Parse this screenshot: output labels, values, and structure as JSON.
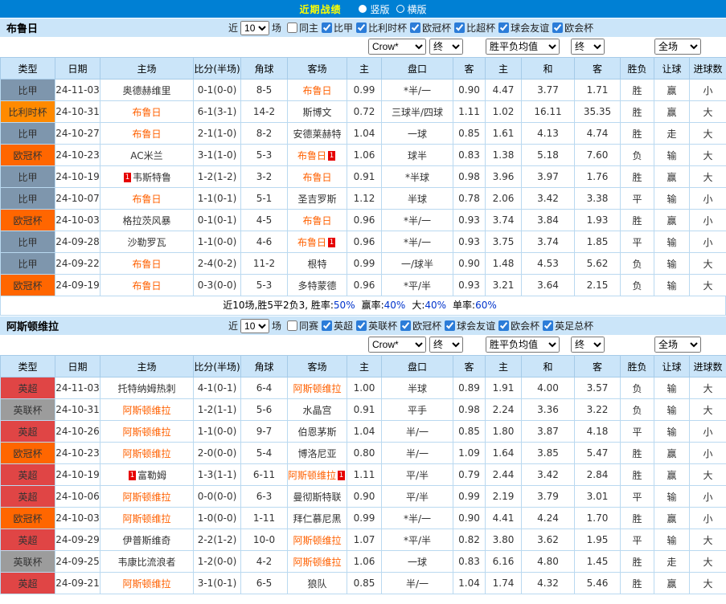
{
  "topbar": {
    "title": "近期战绩",
    "vertical": "竖版",
    "horizontal": "横版"
  },
  "columns": [
    "类型",
    "日期",
    "主场",
    "比分(半场)",
    "角球",
    "客场",
    "主",
    "盘口",
    "客",
    "主",
    "和",
    "客",
    "胜负",
    "让球",
    "进球数"
  ],
  "league_colors": {
    "比甲": "#7E96AD",
    "比利时杯": "#FF8A00",
    "欧冠杯": "#FF6600",
    "英超": "#E04545",
    "英联杯": "#9C9C9C"
  },
  "sections": [
    {
      "team": "布鲁日",
      "near_label": "近",
      "count": "10",
      "unit_label": "场",
      "filters": [
        {
          "label": "同主",
          "checked": false
        },
        {
          "label": "比甲",
          "checked": true
        },
        {
          "label": "比利时杯",
          "checked": true
        },
        {
          "label": "欧冠杯",
          "checked": true
        },
        {
          "label": "比超杯",
          "checked": true
        },
        {
          "label": "球会友谊",
          "checked": true
        },
        {
          "label": "欧会杯",
          "checked": true
        }
      ],
      "selects": [
        "Crow*",
        "终",
        "胜平负均值",
        "终",
        "全场"
      ],
      "rows": [
        {
          "league": "比甲",
          "date": "24-11-03",
          "home": "奥德赫维里",
          "home_hl": false,
          "home_card": "",
          "score": "0-1(0-0)",
          "corner": "8-5",
          "away": "布鲁日",
          "away_hl": true,
          "away_card": "",
          "h1": "0.99",
          "hcap": "*半/一",
          "hcap_c": "r",
          "h2": "0.90",
          "a1": "4.47",
          "a2": "3.77",
          "a3": "1.71",
          "wdl": "胜",
          "wdl_c": "r",
          "hr": "赢",
          "hr_c": "r",
          "ou": "小",
          "ou_c": "b"
        },
        {
          "league": "比利时杯",
          "date": "24-10-31",
          "home": "布鲁日",
          "home_hl": true,
          "home_card": "",
          "score": "6-1(3-1)",
          "corner": "14-2",
          "away": "斯博文",
          "away_hl": false,
          "away_card": "",
          "h1": "0.72",
          "hcap": "三球半/四球",
          "hcap_c": "r",
          "h2": "1.11",
          "a1": "1.02",
          "a2": "16.11",
          "a3": "35.35",
          "wdl": "胜",
          "wdl_c": "r",
          "hr": "赢",
          "hr_c": "r",
          "ou": "大",
          "ou_c": "r"
        },
        {
          "league": "比甲",
          "date": "24-10-27",
          "home": "布鲁日",
          "home_hl": true,
          "home_card": "",
          "score": "2-1(1-0)",
          "corner": "8-2",
          "away": "安德莱赫特",
          "away_hl": false,
          "away_card": "",
          "h1": "1.04",
          "hcap": "一球",
          "hcap_c": "b",
          "h2": "0.85",
          "a1": "1.61",
          "a2": "4.13",
          "a3": "4.74",
          "wdl": "胜",
          "wdl_c": "r",
          "hr": "走",
          "hr_c": "b",
          "ou": "大",
          "ou_c": "r"
        },
        {
          "league": "欧冠杯",
          "date": "24-10-23",
          "home": "AC米兰",
          "home_hl": false,
          "home_card": "",
          "score": "3-1(1-0)",
          "corner": "5-3",
          "away": "布鲁日",
          "away_hl": true,
          "away_card": "1",
          "h1": "1.06",
          "hcap": "球半",
          "hcap_c": "b",
          "h2": "0.83",
          "a1": "1.38",
          "a2": "5.18",
          "a3": "7.60",
          "wdl": "负",
          "wdl_c": "g",
          "hr": "输",
          "hr_c": "g",
          "ou": "大",
          "ou_c": "r"
        },
        {
          "league": "比甲",
          "date": "24-10-19",
          "home": "韦斯特鲁",
          "home_hl": false,
          "home_card": "1",
          "score": "1-2(1-2)",
          "corner": "3-2",
          "away": "布鲁日",
          "away_hl": true,
          "away_card": "",
          "h1": "0.91",
          "hcap": "*半球",
          "hcap_c": "r",
          "h2": "0.98",
          "a1": "3.96",
          "a2": "3.97",
          "a3": "1.76",
          "wdl": "胜",
          "wdl_c": "r",
          "hr": "赢",
          "hr_c": "r",
          "ou": "大",
          "ou_c": "r"
        },
        {
          "league": "比甲",
          "date": "24-10-07",
          "home": "布鲁日",
          "home_hl": true,
          "home_card": "",
          "score": "1-1(0-1)",
          "corner": "5-1",
          "away": "圣吉罗斯",
          "away_hl": false,
          "away_card": "",
          "h1": "1.12",
          "hcap": "半球",
          "hcap_c": "b",
          "h2": "0.78",
          "a1": "2.06",
          "a2": "3.42",
          "a3": "3.38",
          "wdl": "平",
          "wdl_c": "b",
          "hr": "输",
          "hr_c": "g",
          "ou": "小",
          "ou_c": "b"
        },
        {
          "league": "欧冠杯",
          "date": "24-10-03",
          "home": "格拉茨风暴",
          "home_hl": false,
          "home_card": "",
          "score": "0-1(0-1)",
          "corner": "4-5",
          "away": "布鲁日",
          "away_hl": true,
          "away_card": "",
          "h1": "0.96",
          "hcap": "*半/一",
          "hcap_c": "r",
          "h2": "0.93",
          "a1": "3.74",
          "a2": "3.84",
          "a3": "1.93",
          "wdl": "胜",
          "wdl_c": "r",
          "hr": "赢",
          "hr_c": "r",
          "ou": "小",
          "ou_c": "b"
        },
        {
          "league": "比甲",
          "date": "24-09-28",
          "home": "沙勒罗瓦",
          "home_hl": false,
          "home_card": "",
          "score": "1-1(0-0)",
          "corner": "4-6",
          "away": "布鲁日",
          "away_hl": true,
          "away_card": "1",
          "h1": "0.96",
          "hcap": "*半/一",
          "hcap_c": "r",
          "h2": "0.93",
          "a1": "3.75",
          "a2": "3.74",
          "a3": "1.85",
          "wdl": "平",
          "wdl_c": "b",
          "hr": "输",
          "hr_c": "g",
          "ou": "小",
          "ou_c": "b"
        },
        {
          "league": "比甲",
          "date": "24-09-22",
          "home": "布鲁日",
          "home_hl": true,
          "home_card": "",
          "score": "2-4(0-2)",
          "corner": "11-2",
          "away": "根特",
          "away_hl": false,
          "away_card": "",
          "h1": "0.99",
          "hcap": "一/球半",
          "hcap_c": "b",
          "h2": "0.90",
          "a1": "1.48",
          "a2": "4.53",
          "a3": "5.62",
          "wdl": "负",
          "wdl_c": "g",
          "hr": "输",
          "hr_c": "g",
          "ou": "大",
          "ou_c": "r"
        },
        {
          "league": "欧冠杯",
          "date": "24-09-19",
          "home": "布鲁日",
          "home_hl": true,
          "home_card": "",
          "score": "0-3(0-0)",
          "corner": "5-3",
          "away": "多特蒙德",
          "away_hl": false,
          "away_card": "",
          "h1": "0.96",
          "hcap": "*平/半",
          "hcap_c": "r",
          "h2": "0.93",
          "a1": "3.21",
          "a2": "3.64",
          "a3": "2.15",
          "wdl": "负",
          "wdl_c": "g",
          "hr": "输",
          "hr_c": "g",
          "ou": "大",
          "ou_c": "r"
        }
      ],
      "summary": {
        "lead": "近10场,胜5平2负3, ",
        "stats": [
          {
            "label": "胜率:",
            "value": "50%"
          },
          {
            "label": "赢率:",
            "value": "40%"
          },
          {
            "label": "大:",
            "value": "40%"
          },
          {
            "label": "单率:",
            "value": "60%"
          }
        ]
      }
    },
    {
      "team": "阿斯顿维拉",
      "near_label": "近",
      "count": "10",
      "unit_label": "场",
      "filters": [
        {
          "label": "同赛",
          "checked": false
        },
        {
          "label": "英超",
          "checked": true
        },
        {
          "label": "英联杯",
          "checked": true
        },
        {
          "label": "欧冠杯",
          "checked": true
        },
        {
          "label": "球会友谊",
          "checked": true
        },
        {
          "label": "欧会杯",
          "checked": true
        },
        {
          "label": "英足总杯",
          "checked": true
        }
      ],
      "selects": [
        "Crow*",
        "终",
        "胜平负均值",
        "终",
        "全场"
      ],
      "rows": [
        {
          "league": "英超",
          "date": "24-11-03",
          "home": "托特纳姆热刺",
          "home_hl": false,
          "home_card": "",
          "score": "4-1(0-1)",
          "corner": "6-4",
          "away": "阿斯顿维拉",
          "away_hl": true,
          "away_card": "",
          "h1": "1.00",
          "hcap": "半球",
          "hcap_c": "b",
          "h2": "0.89",
          "a1": "1.91",
          "a2": "4.00",
          "a3": "3.57",
          "wdl": "负",
          "wdl_c": "g",
          "hr": "输",
          "hr_c": "g",
          "ou": "大",
          "ou_c": "r"
        },
        {
          "league": "英联杯",
          "date": "24-10-31",
          "home": "阿斯顿维拉",
          "home_hl": true,
          "home_card": "",
          "score": "1-2(1-1)",
          "corner": "5-6",
          "away": "水晶宫",
          "away_hl": false,
          "away_card": "",
          "h1": "0.91",
          "hcap": "平手",
          "hcap_c": "b",
          "h2": "0.98",
          "a1": "2.24",
          "a2": "3.36",
          "a3": "3.22",
          "wdl": "负",
          "wdl_c": "g",
          "hr": "输",
          "hr_c": "g",
          "ou": "大",
          "ou_c": "r"
        },
        {
          "league": "英超",
          "date": "24-10-26",
          "home": "阿斯顿维拉",
          "home_hl": true,
          "home_card": "",
          "score": "1-1(0-0)",
          "corner": "9-7",
          "away": "伯恩茅斯",
          "away_hl": false,
          "away_card": "",
          "h1": "1.04",
          "hcap": "半/一",
          "hcap_c": "b",
          "h2": "0.85",
          "a1": "1.80",
          "a2": "3.87",
          "a3": "4.18",
          "wdl": "平",
          "wdl_c": "b",
          "hr": "输",
          "hr_c": "g",
          "ou": "小",
          "ou_c": "b"
        },
        {
          "league": "欧冠杯",
          "date": "24-10-23",
          "home": "阿斯顿维拉",
          "home_hl": true,
          "home_card": "",
          "score": "2-0(0-0)",
          "corner": "5-4",
          "away": "博洛尼亚",
          "away_hl": false,
          "away_card": "",
          "h1": "0.80",
          "hcap": "半/一",
          "hcap_c": "b",
          "h2": "1.09",
          "a1": "1.64",
          "a2": "3.85",
          "a3": "5.47",
          "wdl": "胜",
          "wdl_c": "r",
          "hr": "赢",
          "hr_c": "r",
          "ou": "小",
          "ou_c": "b"
        },
        {
          "league": "英超",
          "date": "24-10-19",
          "home": "富勒姆",
          "home_hl": false,
          "home_card": "1",
          "score": "1-3(1-1)",
          "corner": "6-11",
          "away": "阿斯顿维拉",
          "away_hl": true,
          "away_card": "1",
          "h1": "1.11",
          "hcap": "平/半",
          "hcap_c": "b",
          "h2": "0.79",
          "a1": "2.44",
          "a2": "3.42",
          "a3": "2.84",
          "wdl": "胜",
          "wdl_c": "r",
          "hr": "赢",
          "hr_c": "r",
          "ou": "大",
          "ou_c": "r"
        },
        {
          "league": "英超",
          "date": "24-10-06",
          "home": "阿斯顿维拉",
          "home_hl": true,
          "home_card": "",
          "score": "0-0(0-0)",
          "corner": "6-3",
          "away": "曼彻斯特联",
          "away_hl": false,
          "away_card": "",
          "h1": "0.90",
          "hcap": "平/半",
          "hcap_c": "b",
          "h2": "0.99",
          "a1": "2.19",
          "a2": "3.79",
          "a3": "3.01",
          "wdl": "平",
          "wdl_c": "b",
          "hr": "输",
          "hr_c": "g",
          "ou": "小",
          "ou_c": "b"
        },
        {
          "league": "欧冠杯",
          "date": "24-10-03",
          "home": "阿斯顿维拉",
          "home_hl": true,
          "home_card": "",
          "score": "1-0(0-0)",
          "corner": "1-11",
          "away": "拜仁慕尼黑",
          "away_hl": false,
          "away_card": "",
          "h1": "0.99",
          "hcap": "*半/一",
          "hcap_c": "r",
          "h2": "0.90",
          "a1": "4.41",
          "a2": "4.24",
          "a3": "1.70",
          "wdl": "胜",
          "wdl_c": "r",
          "hr": "赢",
          "hr_c": "r",
          "ou": "小",
          "ou_c": "b"
        },
        {
          "league": "英超",
          "date": "24-09-29",
          "home": "伊普斯维奇",
          "home_hl": false,
          "home_card": "",
          "score": "2-2(1-2)",
          "corner": "10-0",
          "away": "阿斯顿维拉",
          "away_hl": true,
          "away_card": "",
          "h1": "1.07",
          "hcap": "*平/半",
          "hcap_c": "r",
          "h2": "0.82",
          "a1": "3.80",
          "a2": "3.62",
          "a3": "1.95",
          "wdl": "平",
          "wdl_c": "b",
          "hr": "输",
          "hr_c": "g",
          "ou": "大",
          "ou_c": "r"
        },
        {
          "league": "英联杯",
          "date": "24-09-25",
          "home": "韦康比流浪者",
          "home_hl": false,
          "home_card": "",
          "score": "1-2(0-0)",
          "corner": "4-2",
          "away": "阿斯顿维拉",
          "away_hl": true,
          "away_card": "",
          "h1": "1.06",
          "hcap": "一球",
          "hcap_c": "b",
          "h2": "0.83",
          "a1": "6.16",
          "a2": "4.80",
          "a3": "1.45",
          "wdl": "胜",
          "wdl_c": "r",
          "hr": "走",
          "hr_c": "b",
          "ou": "大",
          "ou_c": "r"
        },
        {
          "league": "英超",
          "date": "24-09-21",
          "home": "阿斯顿维拉",
          "home_hl": true,
          "home_card": "",
          "score": "3-1(0-1)",
          "corner": "6-5",
          "away": "狼队",
          "away_hl": false,
          "away_card": "",
          "h1": "0.85",
          "hcap": "半/一",
          "hcap_c": "b",
          "h2": "1.04",
          "a1": "1.74",
          "a2": "4.32",
          "a3": "5.46",
          "wdl": "胜",
          "wdl_c": "r",
          "hr": "赢",
          "hr_c": "r",
          "ou": "大",
          "ou_c": "r"
        }
      ],
      "summary": null
    }
  ]
}
